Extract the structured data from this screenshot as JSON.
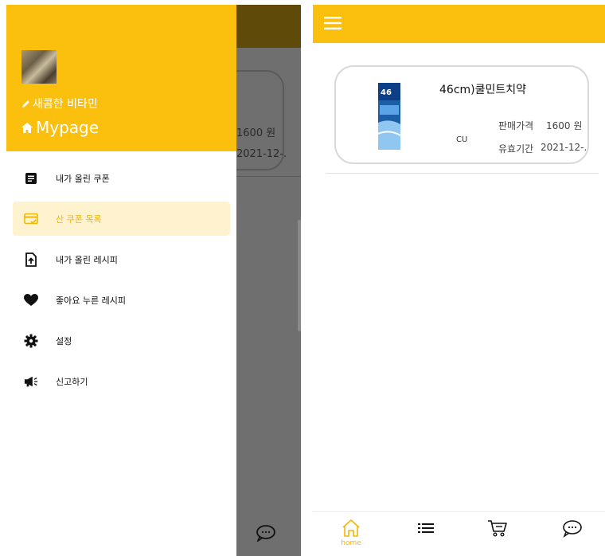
{
  "left_screen": {
    "background": {
      "price_text": "1600 원",
      "date_text": "2021-12-."
    },
    "drawer": {
      "nickname": "새콤한 비타민",
      "mypage_label": "Mypage",
      "header_color": "#fbbf0e",
      "menu": [
        {
          "label": "내가 올린 쿠폰",
          "icon": "document-icon",
          "active": false
        },
        {
          "label": "산 쿠폰 목록",
          "icon": "card-check-icon",
          "active": true
        },
        {
          "label": "내가 올린 레시피",
          "icon": "file-upload-icon",
          "active": false
        },
        {
          "label": "좋아요 누른 레시피",
          "icon": "heart-icon",
          "active": false
        },
        {
          "label": "설정",
          "icon": "gear-icon",
          "active": false
        },
        {
          "label": "신고하기",
          "icon": "megaphone-icon",
          "active": false
        }
      ]
    }
  },
  "right_screen": {
    "topbar_color": "#fbbf0e",
    "coupon": {
      "name": "46cm)쿨민트치약",
      "store": "CU",
      "price_label": "판매가격",
      "price_value": "1600 원",
      "date_label": "유효기간",
      "date_value": "2021-12-."
    },
    "bottom_nav": [
      {
        "label": "home",
        "icon": "home-icon",
        "active": true
      },
      {
        "label": "",
        "icon": "list-icon",
        "active": false
      },
      {
        "label": "",
        "icon": "cart-icon",
        "active": false
      },
      {
        "label": "",
        "icon": "chat-icon",
        "active": false
      }
    ],
    "accent_color": "#f2b705"
  }
}
